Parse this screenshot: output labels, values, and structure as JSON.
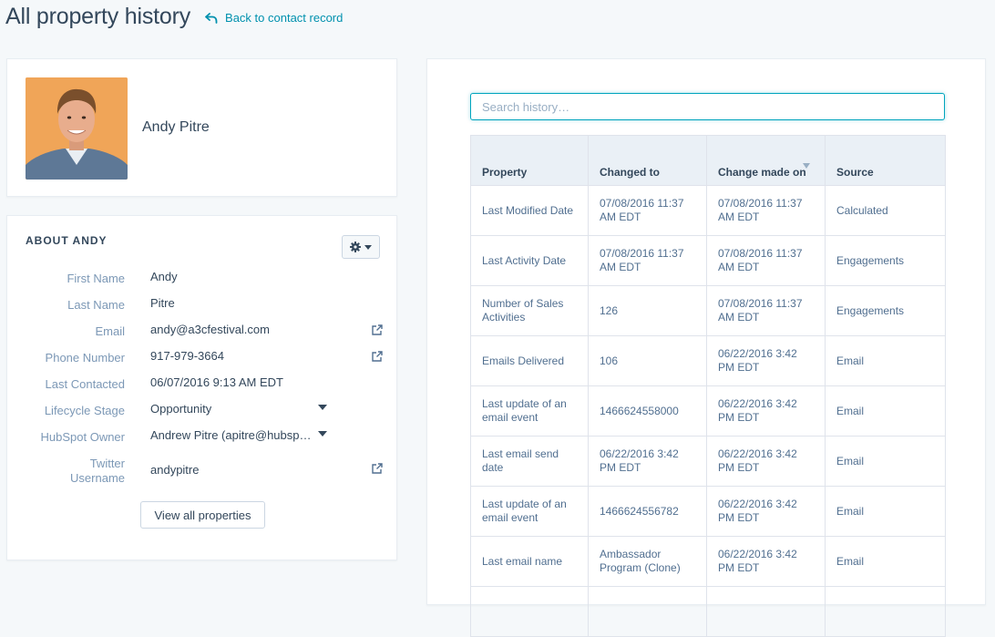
{
  "header": {
    "title": "All property history",
    "back_link": "Back to contact record"
  },
  "profile": {
    "name": "Andy Pitre"
  },
  "about": {
    "title": "ABOUT ANDY",
    "properties": [
      {
        "label": "First Name",
        "value": "Andy"
      },
      {
        "label": "Last Name",
        "value": "Pitre"
      },
      {
        "label": "Email",
        "value": "andy@a3cfestival.com"
      },
      {
        "label": "Phone Number",
        "value": "917-979-3664"
      },
      {
        "label": "Last Contacted",
        "value": "06/07/2016 9:13 AM EDT"
      },
      {
        "label": "Lifecycle Stage",
        "value": "Opportunity"
      },
      {
        "label": "HubSpot Owner",
        "value": "Andrew Pitre (apitre@hubspot.com)"
      },
      {
        "label": "Twitter Username",
        "value": "andypitre"
      }
    ],
    "view_all_label": "View all properties"
  },
  "history": {
    "search_placeholder": "Search history…",
    "columns": [
      "Property",
      "Changed to",
      "Change made on",
      "Source"
    ],
    "rows": [
      [
        "Last Modified Date",
        "07/08/2016 11:37 AM EDT",
        "07/08/2016 11:37 AM EDT",
        "Calculated"
      ],
      [
        "Last Activity Date",
        "07/08/2016 11:37 AM EDT",
        "07/08/2016 11:37 AM EDT",
        "Engagements"
      ],
      [
        "Number of Sales Activities",
        "126",
        "07/08/2016 11:37 AM EDT",
        "Engagements"
      ],
      [
        "Emails Delivered",
        "106",
        "06/22/2016 3:42 PM EDT",
        "Email"
      ],
      [
        "Last update of an email event",
        "1466624558000",
        "06/22/2016 3:42 PM EDT",
        "Email"
      ],
      [
        "Last email send date",
        "06/22/2016 3:42 PM EDT",
        "06/22/2016 3:42 PM EDT",
        "Email"
      ],
      [
        "Last update of an email event",
        "1466624556782",
        "06/22/2016 3:42 PM EDT",
        "Email"
      ],
      [
        "Last email name",
        "Ambassador Program (Clone)",
        "06/22/2016 3:42 PM EDT",
        "Email"
      ]
    ]
  },
  "colors": {
    "accent": "#0091ae",
    "focus": "#00a4bd",
    "background": "#f5f8fa",
    "avatar_bg": "#f0a558"
  }
}
